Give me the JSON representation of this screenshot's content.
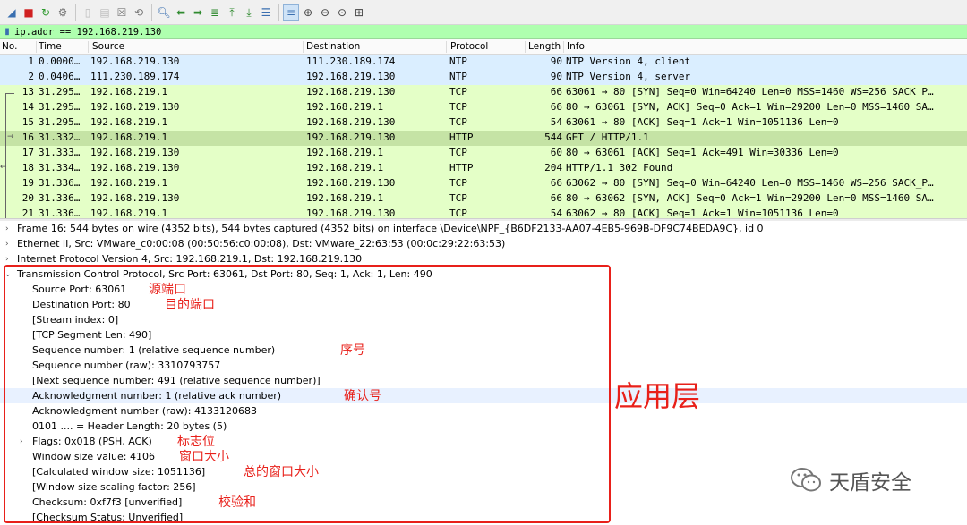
{
  "filter": {
    "value": "ip.addr == 192.168.219.130"
  },
  "columns": {
    "no": "No.",
    "time": "Time",
    "source": "Source",
    "destination": "Destination",
    "protocol": "Protocol",
    "length": "Length",
    "info": "Info"
  },
  "packets": [
    {
      "no": "1",
      "time": "0.0000…",
      "src": "192.168.219.130",
      "dst": "111.230.189.174",
      "proto": "NTP",
      "len": "90",
      "info": "NTP Version 4, client"
    },
    {
      "no": "2",
      "time": "0.0406…",
      "src": "111.230.189.174",
      "dst": "192.168.219.130",
      "proto": "NTP",
      "len": "90",
      "info": "NTP Version 4, server"
    },
    {
      "no": "13",
      "time": "31.295…",
      "src": "192.168.219.1",
      "dst": "192.168.219.130",
      "proto": "TCP",
      "len": "66",
      "info": "63061 → 80 [SYN] Seq=0 Win=64240 Len=0 MSS=1460 WS=256 SACK_P…"
    },
    {
      "no": "14",
      "time": "31.295…",
      "src": "192.168.219.130",
      "dst": "192.168.219.1",
      "proto": "TCP",
      "len": "66",
      "info": "80 → 63061 [SYN, ACK] Seq=0 Ack=1 Win=29200 Len=0 MSS=1460 SA…"
    },
    {
      "no": "15",
      "time": "31.295…",
      "src": "192.168.219.1",
      "dst": "192.168.219.130",
      "proto": "TCP",
      "len": "54",
      "info": "63061 → 80 [ACK] Seq=1 Ack=1 Win=1051136 Len=0"
    },
    {
      "no": "16",
      "time": "31.332…",
      "src": "192.168.219.1",
      "dst": "192.168.219.130",
      "proto": "HTTP",
      "len": "544",
      "info": "GET / HTTP/1.1"
    },
    {
      "no": "17",
      "time": "31.333…",
      "src": "192.168.219.130",
      "dst": "192.168.219.1",
      "proto": "TCP",
      "len": "60",
      "info": "80 → 63061 [ACK] Seq=1 Ack=491 Win=30336 Len=0"
    },
    {
      "no": "18",
      "time": "31.334…",
      "src": "192.168.219.130",
      "dst": "192.168.219.1",
      "proto": "HTTP",
      "len": "204",
      "info": "HTTP/1.1 302 Found"
    },
    {
      "no": "19",
      "time": "31.336…",
      "src": "192.168.219.1",
      "dst": "192.168.219.130",
      "proto": "TCP",
      "len": "66",
      "info": "63062 → 80 [SYN] Seq=0 Win=64240 Len=0 MSS=1460 WS=256 SACK_P…"
    },
    {
      "no": "20",
      "time": "31.336…",
      "src": "192.168.219.130",
      "dst": "192.168.219.1",
      "proto": "TCP",
      "len": "66",
      "info": "80 → 63062 [SYN, ACK] Seq=0 Ack=1 Win=29200 Len=0 MSS=1460 SA…"
    },
    {
      "no": "21",
      "time": "31.336…",
      "src": "192.168.219.1",
      "dst": "192.168.219.130",
      "proto": "TCP",
      "len": "54",
      "info": "63062 → 80 [ACK] Seq=1 Ack=1 Win=1051136 Len=0"
    }
  ],
  "details": {
    "frame": "Frame 16: 544 bytes on wire (4352 bits), 544 bytes captured (4352 bits) on interface \\Device\\NPF_{B6DF2133-AA07-4EB5-969B-DF9C74BEDA9C}, id 0",
    "ethernet": "Ethernet II, Src: VMware_c0:00:08 (00:50:56:c0:00:08), Dst: VMware_22:63:53 (00:0c:29:22:63:53)",
    "ip": "Internet Protocol Version 4, Src: 192.168.219.1, Dst: 192.168.219.130",
    "tcp": "Transmission Control Protocol, Src Port: 63061, Dst Port: 80, Seq: 1, Ack: 1, Len: 490",
    "tcp_fields": [
      "Source Port: 63061",
      "Destination Port: 80",
      "[Stream index: 0]",
      "[TCP Segment Len: 490]",
      "Sequence number: 1    (relative sequence number)",
      "Sequence number (raw): 3310793757",
      "[Next sequence number: 491    (relative sequence number)]",
      "Acknowledgment number: 1    (relative ack number)",
      "Acknowledgment number (raw): 4133120683",
      "0101 .... = Header Length: 20 bytes (5)",
      "Flags: 0x018 (PSH, ACK)",
      "Window size value: 4106",
      "[Calculated window size: 1051136]",
      "[Window size scaling factor: 256]",
      "Checksum: 0xf7f3 [unverified]",
      "[Checksum Status: Unverified]"
    ]
  },
  "annotations": {
    "source_port": "源端口",
    "dest_port": "目的端口",
    "seq": "序号",
    "ack": "确认号",
    "flags": "标志位",
    "window": "窗口大小",
    "calc_window": "总的窗口大小",
    "checksum": "校验和",
    "layer": "应用层"
  },
  "watermark": {
    "text": "天盾安全"
  },
  "colors": {
    "ntp_row": "#daeeff",
    "tcp_row": "#e4ffc7",
    "selected_row": "#c5e3a5",
    "filter_bg": "#afffaf",
    "annotation": "#e8201a"
  }
}
